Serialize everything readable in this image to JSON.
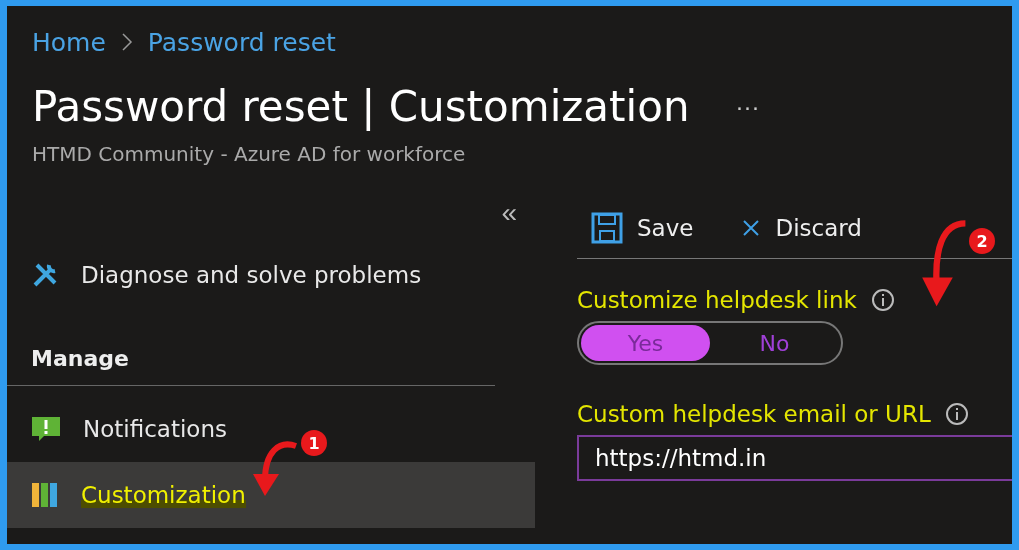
{
  "breadcrumb": [
    {
      "label": "Home"
    },
    {
      "label": "Password reset"
    }
  ],
  "title": "Password reset | Customization",
  "more": "···",
  "subtitle": "HTMD Community - Azure AD for workforce",
  "sidebar": {
    "collapse": "«",
    "items": [
      {
        "kind": "item",
        "label": "Diagnose and solve problems",
        "selected": false,
        "highlighted": false
      },
      {
        "kind": "section",
        "label": "Manage"
      },
      {
        "kind": "item",
        "label": "Notifications",
        "selected": false,
        "highlighted": false
      },
      {
        "kind": "item",
        "label": "Customization",
        "selected": true,
        "highlighted": true
      }
    ]
  },
  "toolbar": [
    {
      "label": "Save"
    },
    {
      "label": "Discard"
    }
  ],
  "fields": [
    {
      "kind": "toggle",
      "label": "Customize helpdesk link",
      "highlighted": true,
      "options": [
        {
          "label": "Yes",
          "selected": true
        },
        {
          "label": "No",
          "selected": false
        }
      ]
    },
    {
      "kind": "text",
      "label": "Custom helpdesk email or URL",
      "highlighted": true,
      "value": "https://htmd.in"
    }
  ],
  "callouts": [
    {
      "number": "1"
    },
    {
      "number": "2"
    }
  ]
}
